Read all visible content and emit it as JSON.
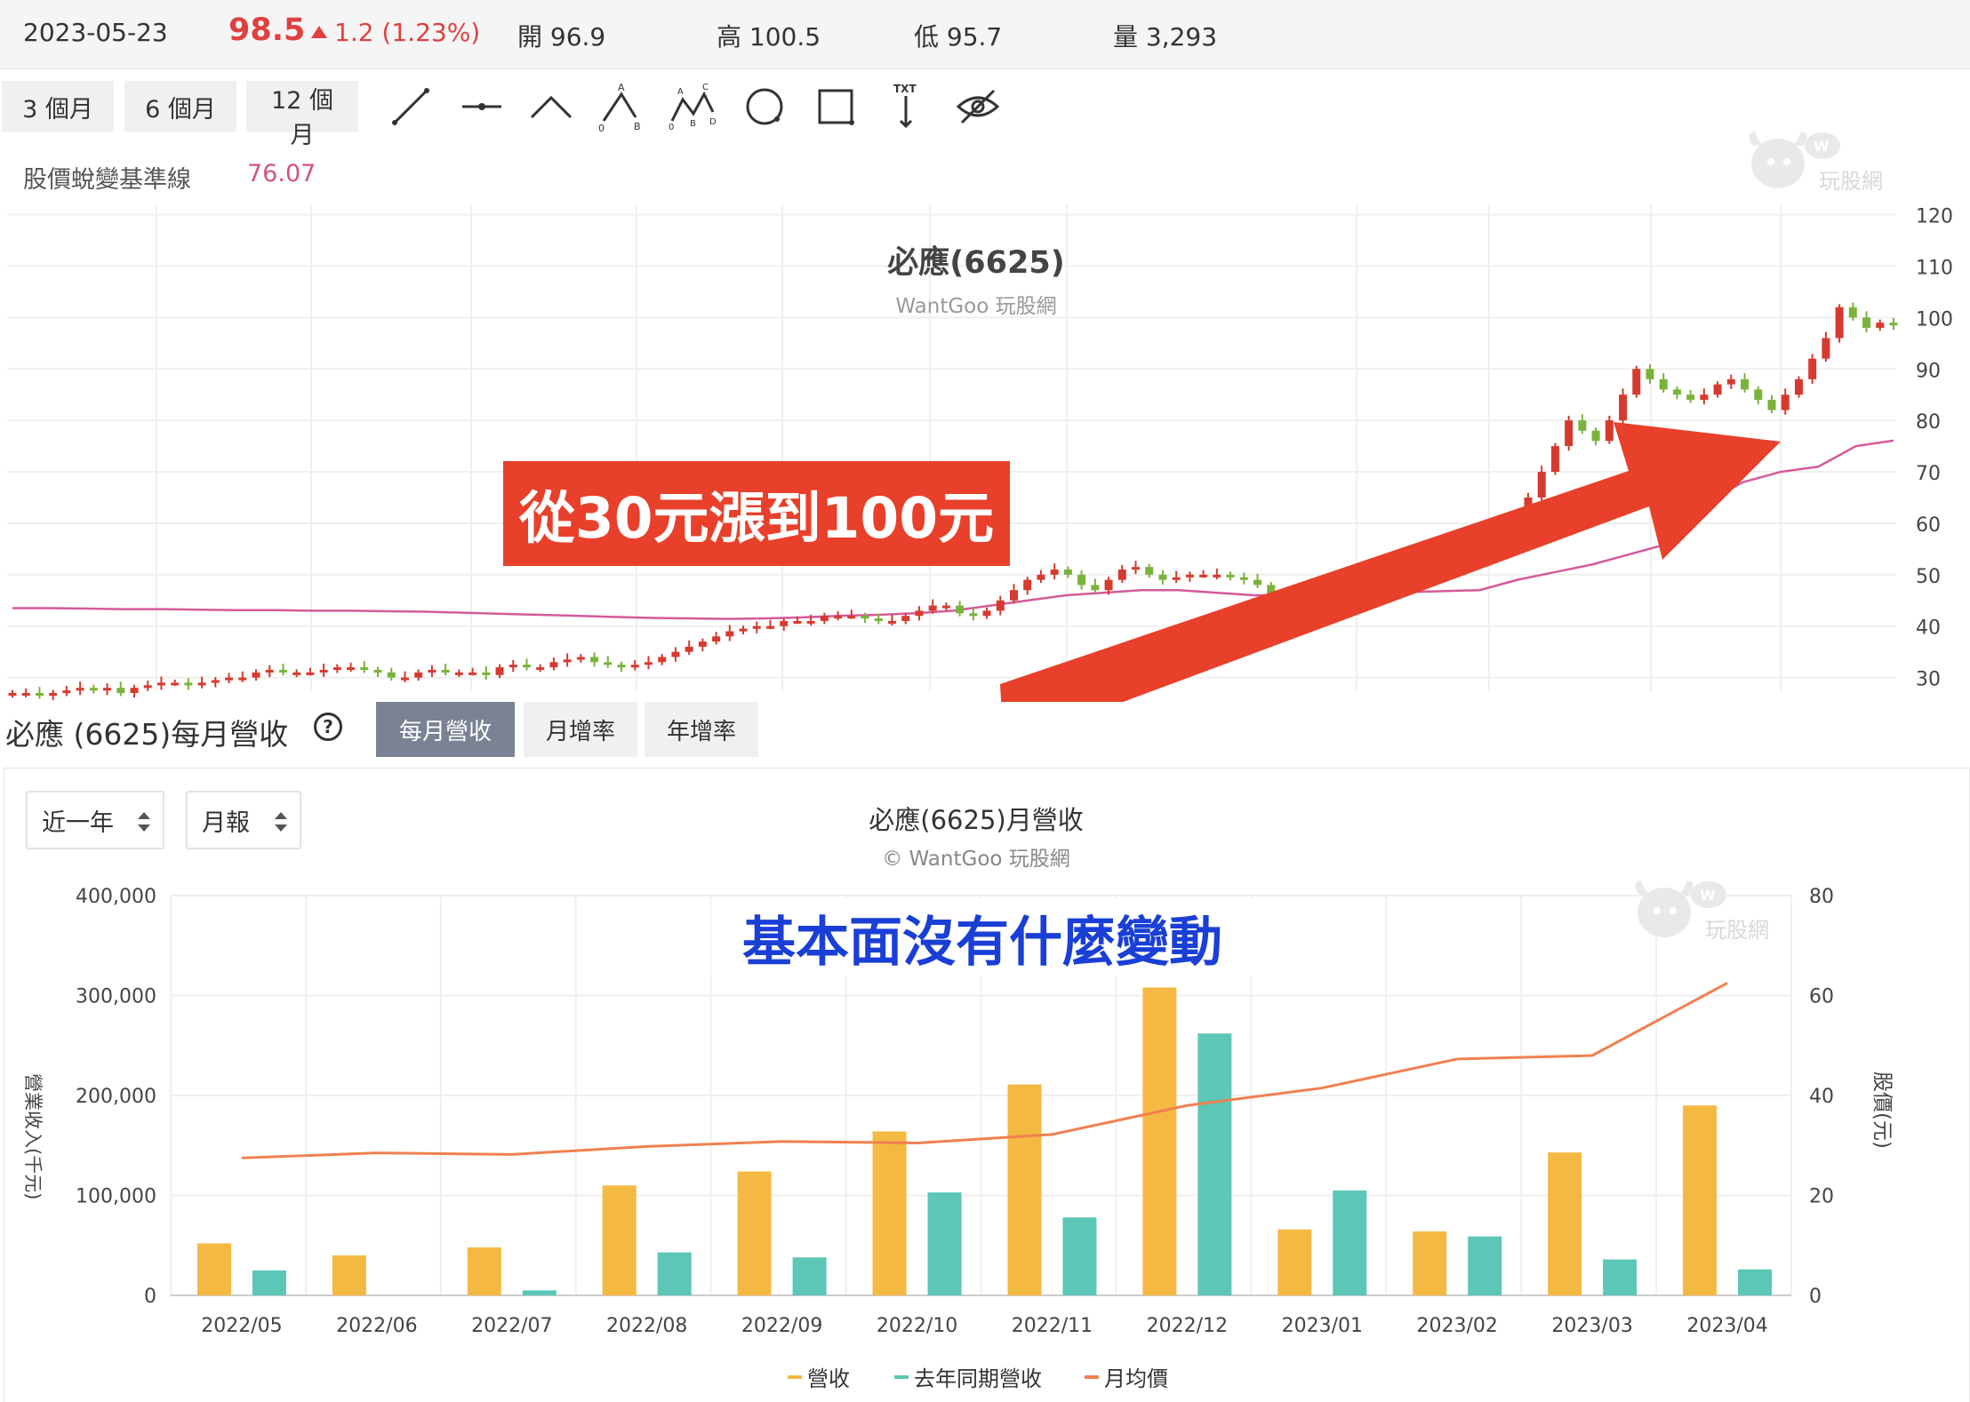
{
  "quote": {
    "date": "2023-05-23",
    "price": "98.5",
    "change": "1.2 (1.23%)",
    "open": "開 96.9",
    "high": "高 100.5",
    "low": "低 95.7",
    "volume": "量 3,293"
  },
  "toolbar": {
    "ranges": [
      "3 個月",
      "6 個月",
      "12 個月"
    ],
    "tools": [
      "line-tool-icon",
      "horizontal-line-tool-icon",
      "angle-tool-icon",
      "abc-pattern-tool-icon",
      "abcd-pattern-tool-icon",
      "circle-tool-icon",
      "rectangle-tool-icon",
      "text-tool-icon",
      "hide-eye-icon"
    ],
    "text_tool_label": "TXT"
  },
  "baseline": {
    "label": "股價蛻變基準線",
    "value": "76.07"
  },
  "watermark": {
    "text": "玩股網"
  },
  "callout": {
    "text": "從30元漲到100元"
  },
  "note": {
    "text": "基本面沒有什麼變動"
  },
  "colors": {
    "up": "#e04040",
    "candle_up": "#d63a2f",
    "candle_down": "#7ab33b",
    "baseline": "#d55a9b",
    "callout": "#e8402a",
    "revenue": "#f4b942",
    "last_year": "#5cc7b6",
    "avg_price": "#f08050",
    "note": "#1a3fd6"
  },
  "revenue": {
    "title": "必應 (6625)每月營收",
    "tabs": [
      "每月營收",
      "月增率",
      "年增率"
    ],
    "period_select": "近一年",
    "type_select": "月報"
  },
  "chart_data": [
    {
      "type": "line",
      "title": "必應(6625)",
      "subtitle": "WantGoo 玩股網",
      "y_right_ticks": [
        "30",
        "40",
        "50",
        "60",
        "70",
        "80",
        "90",
        "100",
        "110",
        "120"
      ],
      "ylim": [
        27,
        122
      ],
      "grid": true,
      "series": [
        {
          "type": "candlestick",
          "approx_close": [
            27,
            27,
            26.5,
            27,
            27.5,
            28,
            27.5,
            28,
            27,
            28,
            28.5,
            29,
            29,
            28.5,
            29,
            29.5,
            30,
            30,
            31,
            31.5,
            31,
            31,
            31,
            31.5,
            32,
            32,
            31.5,
            31,
            30,
            30,
            31,
            31.5,
            31,
            31,
            31,
            30.5,
            32,
            32.5,
            32,
            32,
            33,
            33.5,
            34,
            33,
            32.5,
            32,
            32.5,
            33,
            34,
            35,
            36,
            37,
            38,
            39,
            39.5,
            40,
            40,
            41,
            41,
            41,
            42,
            42,
            42,
            41.5,
            41,
            41,
            42,
            43,
            44,
            44,
            42.5,
            42,
            43,
            45,
            47,
            49,
            50,
            51,
            50,
            48,
            47,
            49,
            51,
            51.5,
            50,
            49,
            49.5,
            50,
            50,
            50,
            49.5,
            49,
            48,
            46,
            45,
            45,
            46,
            48,
            48,
            49,
            48,
            48,
            48.5,
            49,
            50,
            51,
            52,
            52,
            53,
            54,
            56,
            60,
            65,
            70,
            75,
            80,
            78,
            76,
            80,
            85,
            90,
            88,
            86,
            85,
            84,
            85,
            87,
            88,
            86,
            84,
            82,
            85,
            88,
            92,
            96,
            102,
            100,
            98,
            99,
            98.5
          ]
        },
        {
          "type": "line",
          "name": "股價蛻變基準線",
          "approx_values": [
            43.5,
            43.5,
            43.4,
            43.3,
            43.3,
            43.2,
            43.1,
            43.1,
            43.0,
            43.0,
            42.9,
            42.8,
            42.6,
            42.4,
            42.2,
            42.0,
            41.8,
            41.6,
            41.5,
            41.4,
            41.5,
            41.7,
            42.0,
            42.2,
            42.5,
            43.0,
            44.0,
            45.0,
            46.0,
            46.5,
            47.0,
            47.0,
            46.5,
            46.0,
            46.0,
            46.2,
            46.4,
            46.6,
            46.8,
            47.0,
            49.0,
            50.5,
            52.0,
            54.0,
            56.0,
            64.0,
            68.0,
            70.0,
            71.0,
            75.0,
            76.07
          ]
        }
      ]
    },
    {
      "type": "bar",
      "title": "必應(6625)月營收",
      "subtitle": "© WantGoo 玩股網",
      "categories": [
        "2022/05",
        "2022/06",
        "2022/07",
        "2022/08",
        "2022/09",
        "2022/10",
        "2022/11",
        "2022/12",
        "2023/01",
        "2023/02",
        "2023/03",
        "2023/04"
      ],
      "ylabel_left": "營業收入(千元)",
      "ylabel_right": "股價(元)",
      "ylim_left": [
        0,
        400000
      ],
      "ylim_right": [
        0,
        80
      ],
      "y_left_ticks": [
        "0",
        "100,000",
        "200,000",
        "300,000",
        "400,000"
      ],
      "y_right_ticks": [
        "0",
        "20",
        "40",
        "60",
        "80"
      ],
      "grid": true,
      "legend_position": "bottom",
      "series": [
        {
          "name": "營收",
          "type": "bar",
          "values": [
            52000,
            40000,
            48000,
            110000,
            124000,
            164000,
            211000,
            308000,
            66000,
            64000,
            143000,
            190000
          ]
        },
        {
          "name": "去年同期營收",
          "type": "bar",
          "values": [
            25000,
            0,
            5000,
            43000,
            38000,
            103000,
            78000,
            262000,
            105000,
            59000,
            36000,
            26000
          ]
        },
        {
          "name": "月均價",
          "type": "line",
          "values": [
            27.5,
            28.5,
            28.2,
            29.8,
            30.8,
            30.5,
            32.2,
            38.0,
            41.5,
            47.3,
            48.0,
            62.5
          ]
        }
      ]
    }
  ]
}
